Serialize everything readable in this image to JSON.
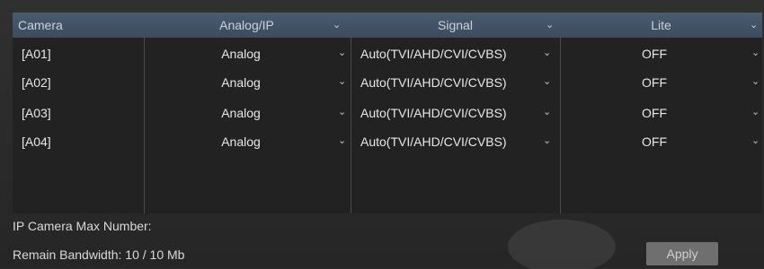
{
  "header": {
    "camera": "Camera",
    "analog_ip": "Analog/IP",
    "signal": "Signal",
    "lite": "Lite"
  },
  "rows": [
    {
      "camera": "[A01]",
      "analog_ip": "Analog",
      "signal": "Auto(TVI/AHD/CVI/CVBS)",
      "lite": "OFF"
    },
    {
      "camera": "[A02]",
      "analog_ip": "Analog",
      "signal": "Auto(TVI/AHD/CVI/CVBS)",
      "lite": "OFF"
    },
    {
      "camera": "[A03]",
      "analog_ip": "Analog",
      "signal": "Auto(TVI/AHD/CVI/CVBS)",
      "lite": "OFF"
    },
    {
      "camera": "[A04]",
      "analog_ip": "Analog",
      "signal": "Auto(TVI/AHD/CVI/CVBS)",
      "lite": "OFF"
    }
  ],
  "footer": {
    "ip_camera_max": "IP Camera Max Number:",
    "remain_bandwidth": "Remain Bandwidth: 10 / 10 Mb",
    "apply_label": "Apply"
  },
  "icons": {
    "dropdown": "chevron-down-icon"
  }
}
